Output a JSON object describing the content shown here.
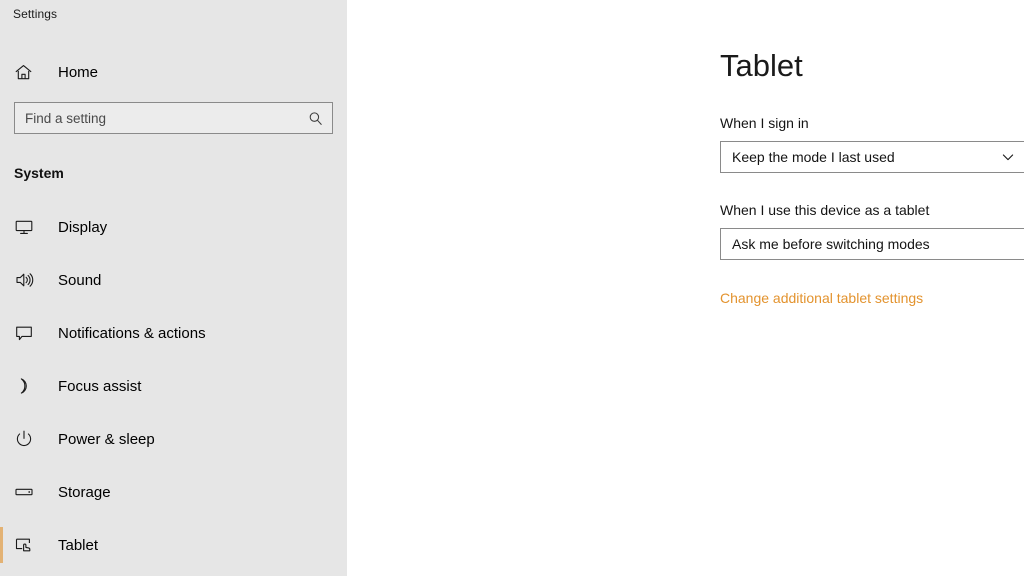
{
  "window": {
    "title": "Settings"
  },
  "sidebar": {
    "home": {
      "label": "Home",
      "icon": "home-icon"
    },
    "search": {
      "placeholder": "Find a setting",
      "value": "",
      "icon": "search-icon"
    },
    "group_header": "System",
    "items": [
      {
        "label": "Display",
        "icon": "monitor-icon",
        "selected": false
      },
      {
        "label": "Sound",
        "icon": "speaker-icon",
        "selected": false
      },
      {
        "label": "Notifications & actions",
        "icon": "comment-balloon-icon",
        "selected": false
      },
      {
        "label": "Focus assist",
        "icon": "crescent-moon-icon",
        "selected": false
      },
      {
        "label": "Power & sleep",
        "icon": "power-icon",
        "selected": false
      },
      {
        "label": "Storage",
        "icon": "disk-drive-icon",
        "selected": false
      },
      {
        "label": "Tablet",
        "icon": "tablet-touch-icon",
        "selected": true
      }
    ]
  },
  "main": {
    "title": "Tablet",
    "fields": [
      {
        "label": "When I sign in",
        "value": "Keep the mode I last used",
        "chevron": "chevron-down-icon"
      },
      {
        "label": "When I use this device as a tablet",
        "value": "Ask me before switching modes",
        "chevron": "chevron-down-icon"
      }
    ],
    "link": "Change additional tablet settings"
  },
  "colors": {
    "accent": "#e3932e",
    "selection_bar": "#e3b274",
    "sidebar_bg": "#e6e6e6",
    "content_bg": "#ffffff",
    "border": "#8a8a8a"
  }
}
